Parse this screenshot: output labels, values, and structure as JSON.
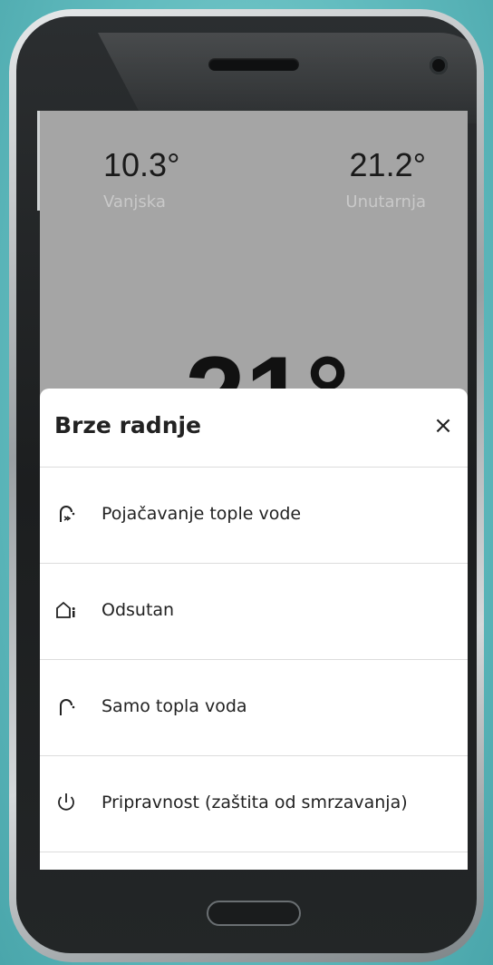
{
  "status": {
    "outdoor_temp": "10.3°",
    "outdoor_label": "Vanjska",
    "indoor_temp": "21.2°",
    "indoor_label": "Unutarnja",
    "setpoint": "21°"
  },
  "sheet": {
    "title": "Brze radnje",
    "close": "×",
    "actions": [
      {
        "label": "Pojačavanje tople vode",
        "icon": "hot-water-boost-icon"
      },
      {
        "label": "Odsutan",
        "icon": "away-house-icon"
      },
      {
        "label": "Samo topla voda",
        "icon": "hot-water-only-icon"
      },
      {
        "label": "Pripravnost (zaštita od smrzavanja)",
        "icon": "power-standby-icon"
      }
    ]
  }
}
